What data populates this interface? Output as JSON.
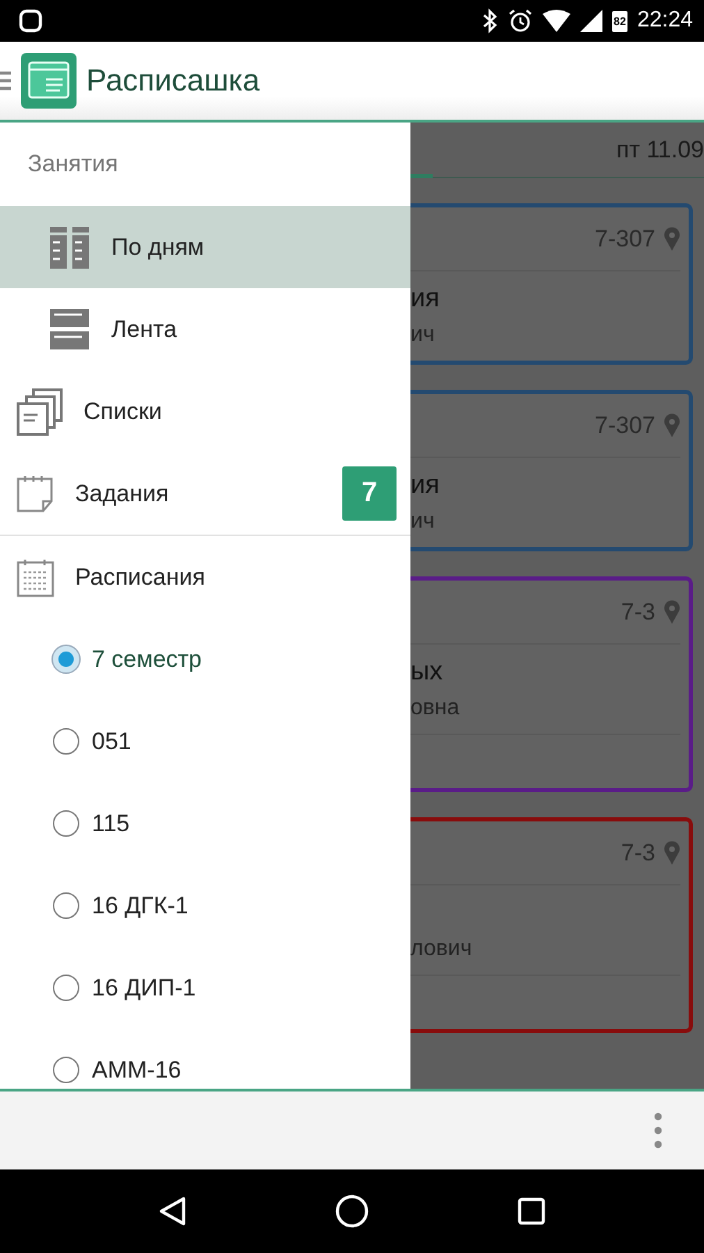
{
  "status_bar": {
    "battery": "82",
    "time": "22:24"
  },
  "app_bar": {
    "title": "Расписашка"
  },
  "background": {
    "date_tab": "пт 11.09",
    "cards": [
      {
        "room": "7-307",
        "title": "ия",
        "subtitle": "ич",
        "color": "#244a70"
      },
      {
        "room": "7-307",
        "title": "ия",
        "subtitle": "ич",
        "color": "#244a70"
      },
      {
        "room": "7-3",
        "title": "ых",
        "subtitle": "овна",
        "color": "#5a1c88"
      },
      {
        "room": "7-3",
        "subtitle": "лович",
        "color": "#880c0c"
      }
    ]
  },
  "drawer": {
    "section": "Занятия",
    "items": [
      {
        "kind": "subview",
        "label": "По дням",
        "selected": true
      },
      {
        "kind": "subview",
        "label": "Лента",
        "selected": false
      },
      {
        "kind": "nav",
        "label": "Списки",
        "selected": false
      },
      {
        "kind": "nav",
        "label": "Задания",
        "selected": false,
        "badge": "7"
      },
      {
        "kind": "group",
        "label": "Расписания",
        "selected": false
      }
    ],
    "schedules": [
      {
        "label": "7 семестр",
        "selected": true
      },
      {
        "label": "051",
        "selected": false
      },
      {
        "label": "115",
        "selected": false
      },
      {
        "label": "16 ДГК-1",
        "selected": false
      },
      {
        "label": "16 ДИП-1",
        "selected": false
      },
      {
        "label": "АММ-16",
        "selected": false
      }
    ]
  }
}
